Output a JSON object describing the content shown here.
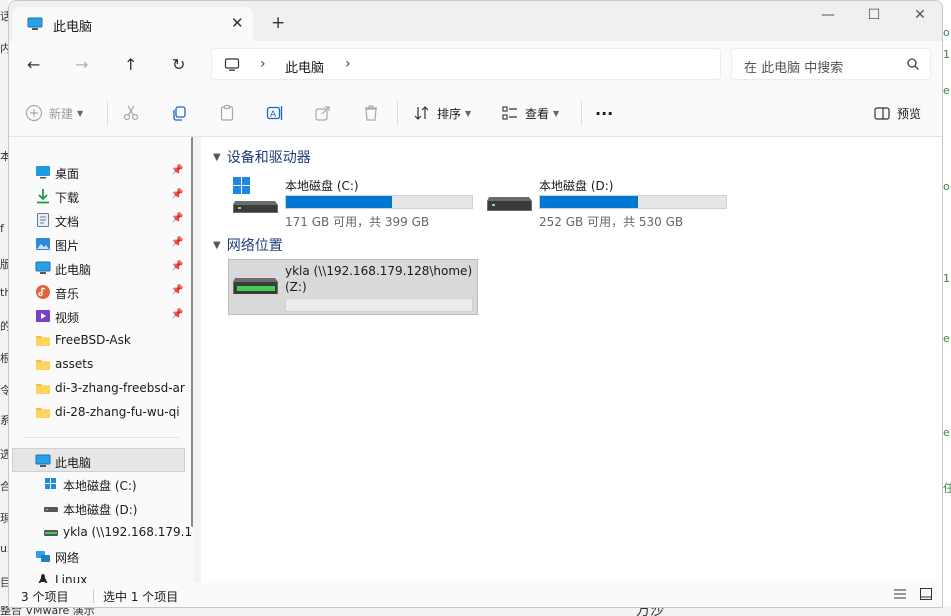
{
  "window": {
    "tab_title": "此电脑",
    "new_tab": "+",
    "minimize": "—",
    "maximize": "☐",
    "close": "✕"
  },
  "nav": {
    "back": "←",
    "forward": "→",
    "up": "↑",
    "refresh": "↻",
    "breadcrumb": "此电脑",
    "sep": "›",
    "search_placeholder": "在 此电脑 中搜索"
  },
  "toolbar": {
    "new_label": "新建",
    "sort_label": "排序",
    "view_label": "查看",
    "more_label": "···",
    "preview_label": "预览"
  },
  "sidebar": {
    "quick_access": [
      {
        "label": "桌面",
        "icon": "desktop-icon",
        "pinned": true
      },
      {
        "label": "下载",
        "icon": "download-icon",
        "pinned": true
      },
      {
        "label": "文档",
        "icon": "document-icon",
        "pinned": true
      },
      {
        "label": "图片",
        "icon": "pictures-icon",
        "pinned": true
      },
      {
        "label": "此电脑",
        "icon": "this-pc-icon",
        "pinned": true
      },
      {
        "label": "音乐",
        "icon": "music-icon",
        "pinned": true
      },
      {
        "label": "视频",
        "icon": "videos-icon",
        "pinned": true
      },
      {
        "label": "FreeBSD-Ask",
        "icon": "folder-icon",
        "pinned": false
      },
      {
        "label": "assets",
        "icon": "folder-icon",
        "pinned": false
      },
      {
        "label": "di-3-zhang-freebsd-ar",
        "icon": "folder-icon",
        "pinned": false
      },
      {
        "label": "di-28-zhang-fu-wu-qi",
        "icon": "folder-icon",
        "pinned": false
      }
    ],
    "this_pc": "此电脑",
    "this_pc_children": [
      {
        "label": "本地磁盘 (C:)",
        "icon": "windows-drive-icon"
      },
      {
        "label": "本地磁盘 (D:)",
        "icon": "drive-icon"
      },
      {
        "label": "ykla (\\\\192.168.179.1",
        "icon": "network-drive-icon"
      }
    ],
    "network": "网络",
    "linux": "Linux"
  },
  "main": {
    "group_devices": "设备和驱动器",
    "group_network": "网络位置",
    "drives": [
      {
        "name": "本地磁盘 (C:)",
        "size": "171 GB 可用，共 399 GB",
        "used_fraction": 0.571
      },
      {
        "name": "本地磁盘 (D:)",
        "size": "252 GB 可用，共 530 GB",
        "used_fraction": 0.525
      }
    ],
    "network_drive": {
      "name_line1": "ykla (\\\\192.168.179.128\\home)",
      "name_line2": "(Z:)"
    }
  },
  "status": {
    "count": "3 个项目",
    "selected": "选中 1 个项目"
  },
  "background": {
    "bottom_left": "整合 VMware 演示",
    "bottom_mid": "万沙"
  },
  "colors": {
    "accent": "#0078d4",
    "header_blue": "#1f3d7a",
    "folder": "#f5c33b"
  }
}
